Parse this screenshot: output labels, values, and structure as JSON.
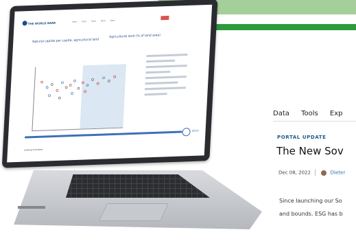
{
  "article": {
    "nav": [
      "Data",
      "Tools",
      "Exp"
    ],
    "kicker": "PORTAL UPDATE",
    "headline": "The New Sov",
    "date": "Dec 08, 2022",
    "author": "Dieter",
    "body_line1": "Since launching our So",
    "body_line2": "and bounds. ESG has b"
  },
  "laptop_screen": {
    "logo": "THE WORLD BANK",
    "menu": [
      "Item",
      "Item",
      "Item",
      "Item",
      "Item"
    ],
    "chart_title_left": "Natural capital per capita, agricultural land",
    "chart_title_right": "Agricultural land (% of land area)",
    "slider_year": "2015",
    "footer": "Loading Animated"
  },
  "colors": {
    "green_light": "#a5cf9a",
    "green_dark": "#2e9a3c",
    "link_blue": "#2a6fb0"
  }
}
